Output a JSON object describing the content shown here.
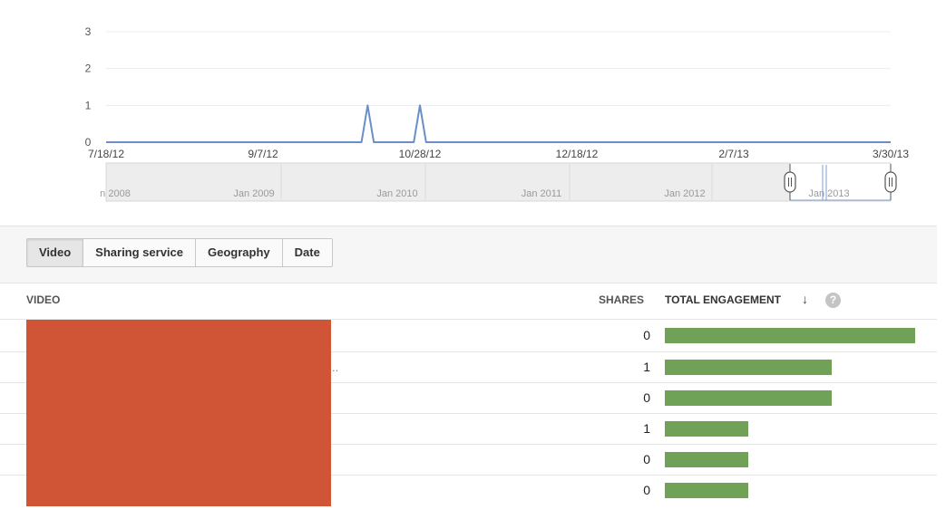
{
  "chart_data": {
    "type": "line",
    "x": [
      "7/18/12",
      "9/7/12",
      "10/11/12",
      "10/28/12",
      "12/18/12",
      "2/7/13",
      "3/30/13"
    ],
    "series": [
      {
        "values_note": "",
        "points": [
          {
            "x": "7/18/12",
            "y": 0
          },
          {
            "x": "10/9/12",
            "y": 0
          },
          {
            "x": "10/11/12",
            "y": 1
          },
          {
            "x": "10/13/12",
            "y": 0
          },
          {
            "x": "10/26/12",
            "y": 0
          },
          {
            "x": "10/28/12",
            "y": 1
          },
          {
            "x": "10/30/12",
            "y": 0
          },
          {
            "x": "3/30/13",
            "y": 0
          }
        ]
      }
    ],
    "x_tick_labels": [
      "7/18/12",
      "9/7/12",
      "10/28/12",
      "12/18/12",
      "2/7/13",
      "3/30/13"
    ],
    "y_tick_labels": [
      "0",
      "1",
      "2",
      "3"
    ],
    "ylim": [
      0,
      3
    ],
    "grid": true,
    "line_color": "#6a8fc6"
  },
  "navigator": {
    "labels": [
      "n 2008",
      "Jan 2009",
      "Jan 2010",
      "Jan 2011",
      "Jan 2012",
      "Jan 2013"
    ]
  },
  "tabs": [
    {
      "label": "Video",
      "active": true
    },
    {
      "label": "Sharing service",
      "active": false
    },
    {
      "label": "Geography",
      "active": false
    },
    {
      "label": "Date",
      "active": false
    }
  ],
  "table": {
    "col_video": "VIDEO",
    "col_shares": "SHARES",
    "col_engagement": "TOTAL ENGAGEMENT",
    "help_glyph": "?",
    "sort_glyph": "↓",
    "ellipsis": "..",
    "rows": [
      {
        "shares": "0",
        "engagement": 3
      },
      {
        "shares": "1",
        "engagement": 2
      },
      {
        "shares": "0",
        "engagement": 2
      },
      {
        "shares": "1",
        "engagement": 1
      },
      {
        "shares": "0",
        "engagement": 1
      },
      {
        "shares": "0",
        "engagement": 1
      }
    ],
    "bar_color": "#6fa257",
    "redaction_color": "#d05537"
  }
}
